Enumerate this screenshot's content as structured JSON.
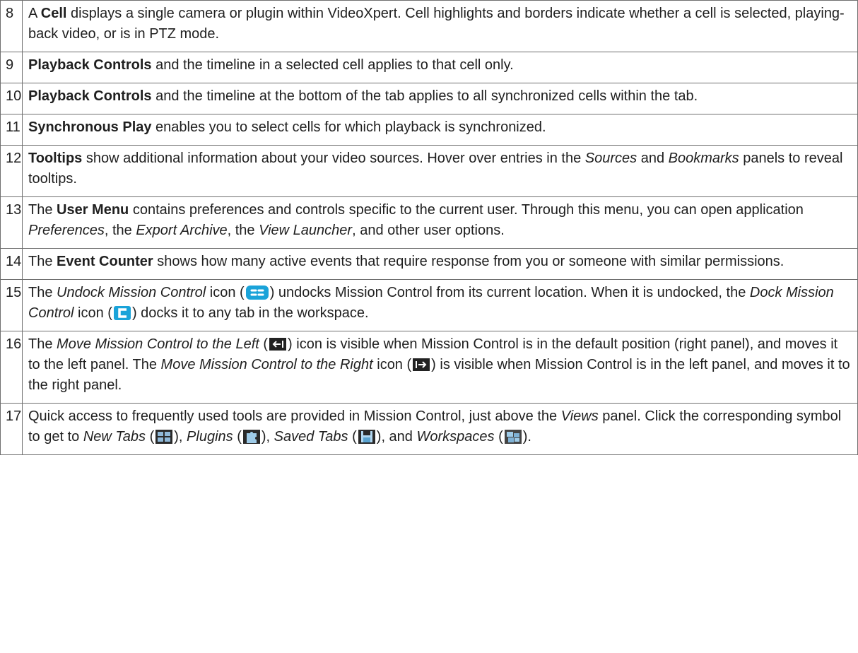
{
  "rows": [
    {
      "num": "8",
      "parts": [
        {
          "t": "A "
        },
        {
          "t": "Cell",
          "s": "b"
        },
        {
          "t": " displays a single camera or plugin within VideoXpert. Cell highlights and borders indicate whether a cell is selected, playing-back video, or is in PTZ mode."
        }
      ]
    },
    {
      "num": "9",
      "parts": [
        {
          "t": "Playback Controls",
          "s": "b"
        },
        {
          "t": " and the timeline in a selected cell applies to that cell only."
        }
      ]
    },
    {
      "num": "10",
      "parts": [
        {
          "t": "Playback Controls",
          "s": "b"
        },
        {
          "t": " and the timeline at the bottom of the tab applies to all synchronized cells within the tab."
        }
      ]
    },
    {
      "num": "11",
      "parts": [
        {
          "t": "Synchronous Play",
          "s": "b"
        },
        {
          "t": " enables you to select cells for which playback is synchronized."
        }
      ]
    },
    {
      "num": "12",
      "parts": [
        {
          "t": "Tooltips",
          "s": "b"
        },
        {
          "t": " show additional information about your video sources. Hover over entries in the "
        },
        {
          "t": "Sources",
          "s": "i"
        },
        {
          "t": " and "
        },
        {
          "t": "Bookmarks",
          "s": "i"
        },
        {
          "t": " panels to reveal tooltips."
        }
      ]
    },
    {
      "num": "13",
      "parts": [
        {
          "t": "The "
        },
        {
          "t": "User Menu",
          "s": "b"
        },
        {
          "t": " contains preferences and controls specific to the current user. Through this menu, you can open application "
        },
        {
          "t": "Preferences",
          "s": "i"
        },
        {
          "t": ", the "
        },
        {
          "t": "Export Archive",
          "s": "i"
        },
        {
          "t": ", the "
        },
        {
          "t": "View Launcher",
          "s": "i"
        },
        {
          "t": ", and other user options."
        }
      ]
    },
    {
      "num": "14",
      "parts": [
        {
          "t": "The "
        },
        {
          "t": "Event Counter",
          "s": "b"
        },
        {
          "t": " shows how many active events that require response from you or someone with similar permissions."
        }
      ]
    },
    {
      "num": "15",
      "parts": [
        {
          "t": "The "
        },
        {
          "t": "Undock Mission Control",
          "s": "i"
        },
        {
          "t": " icon ("
        },
        {
          "icon": "undock-icon"
        },
        {
          "t": ") undocks Mission Control from its current location. When it is undocked, the "
        },
        {
          "t": "Dock Mission Control",
          "s": "i"
        },
        {
          "t": " icon ("
        },
        {
          "icon": "dock-icon"
        },
        {
          "t": ") docks it to any tab in the workspace."
        }
      ]
    },
    {
      "num": "16",
      "parts": [
        {
          "t": "The "
        },
        {
          "t": "Move Mission Control to the Left",
          "s": "i"
        },
        {
          "t": " ("
        },
        {
          "icon": "move-left-icon"
        },
        {
          "t": ") icon is visible when Mission Control is in the default position (right panel), and moves it to the left panel. The "
        },
        {
          "t": "Move Mission Control to the Right",
          "s": "i"
        },
        {
          "t": " icon ("
        },
        {
          "icon": "move-right-icon"
        },
        {
          "t": ") is visible when Mission Control is in the left panel, and moves it to the right panel."
        }
      ]
    },
    {
      "num": "17",
      "parts": [
        {
          "t": "Quick access to frequently used tools are provided in Mission Control, just above the "
        },
        {
          "t": "Views",
          "s": "i"
        },
        {
          "t": " panel. Click the corresponding symbol to get to "
        },
        {
          "t": "New Tabs",
          "s": "i"
        },
        {
          "t": " ("
        },
        {
          "icon": "new-tabs-icon"
        },
        {
          "t": "), "
        },
        {
          "t": "Plugins",
          "s": "i"
        },
        {
          "t": " ("
        },
        {
          "icon": "plugins-icon"
        },
        {
          "t": "), "
        },
        {
          "t": "Saved Tabs",
          "s": "i"
        },
        {
          "t": " ("
        },
        {
          "icon": "saved-tabs-icon"
        },
        {
          "t": "), and "
        },
        {
          "t": "Workspaces",
          "s": "i"
        },
        {
          "t": " ("
        },
        {
          "icon": "workspaces-icon"
        },
        {
          "t": ")."
        }
      ]
    }
  ],
  "colors": {
    "icon_blue": "#1aa3d9",
    "icon_dark": "#222222",
    "border": "#6f6f6f"
  }
}
